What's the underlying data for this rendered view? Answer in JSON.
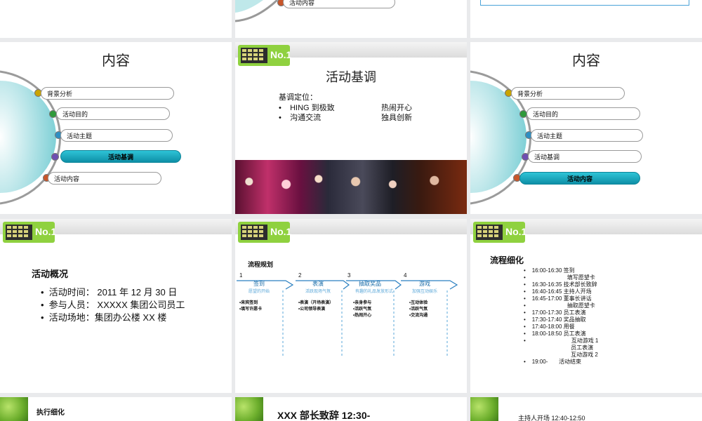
{
  "colors": {
    "teal_accent": "#1aa9bd",
    "menu_dots": [
      "#c9a400",
      "#2f9a3c",
      "#2f8fc2",
      "#6f4fb0",
      "#c8562a"
    ],
    "flow_arrow": "#2a7fc0",
    "flow_sub": "#5aa7d8"
  },
  "slide_top_left": {
    "menu_label": ""
  },
  "slide_top_middle": {
    "menu_label": "活动内容"
  },
  "contents_1": {
    "title": "内容",
    "items": [
      "背景分析",
      "活动目的",
      "活动主题",
      "活动基调",
      "活动内容"
    ],
    "active_index": 3
  },
  "tone": {
    "logo_text": "No.1",
    "title": "活动基调",
    "label": "基调定位：",
    "rows": [
      {
        "left": "HING 到极致",
        "right": "热闹开心"
      },
      {
        "left": "沟通交流",
        "right": "独具创新"
      }
    ]
  },
  "contents_2": {
    "title": "内容",
    "items": [
      "背景分析",
      "活动目的",
      "活动主题",
      "活动基调",
      "活动内容"
    ],
    "active_index": 4
  },
  "overview": {
    "title": "活动概况",
    "items": [
      "活动时间： 2011 年 12 月 30 日",
      "参与人员： XXXXX 集团公司员工",
      "活动场地：集团办公楼 XX 楼"
    ]
  },
  "flow": {
    "title": "流程规划",
    "steps": [
      {
        "num": "1",
        "name": "签到",
        "sub": "愿望的开始",
        "bullets": [
          "来宾签到",
          "填写许愿卡"
        ]
      },
      {
        "num": "2",
        "name": "表演",
        "sub": "活跃现场气氛",
        "bullets": [
          "表演（开场表演）",
          "公司领导表演"
        ]
      },
      {
        "num": "3",
        "name": "抽取奖品",
        "sub": "有趣的礼品发放形式",
        "bullets": [
          "亲身参与",
          "活跃气氛",
          "热闹开心"
        ]
      },
      {
        "num": "4",
        "name": "游戏",
        "sub": "加强互动娱乐",
        "bullets": [
          "互动体验",
          "活跃气氛",
          "交流沟通"
        ]
      }
    ]
  },
  "detail": {
    "title": "流程细化",
    "rows": [
      {
        "time": "16:00-16:30",
        "text": "签到"
      },
      {
        "time": "",
        "text": "填写愿望卡"
      },
      {
        "time": "16:30-16:35",
        "text": "技术部长致辞"
      },
      {
        "time": "16:40-16:45",
        "text": "主持人开场"
      },
      {
        "time": "16:45-17:00",
        "text": "董事长讲话"
      },
      {
        "time": "",
        "text": "抽取愿望卡"
      },
      {
        "time": "17:00-17:30",
        "text": "员工表演"
      },
      {
        "time": "17:30-17:40",
        "text": "奖品抽取"
      },
      {
        "time": "17:40-18:00",
        "text": "用餐"
      },
      {
        "time": "18:00-18:50",
        "text": "员工表演"
      },
      {
        "time": "",
        "text": "互动游戏 1"
      },
      {
        "time": "",
        "text": "员工表演"
      },
      {
        "time": "",
        "text": "互动游戏 2"
      },
      {
        "time": "19:00-",
        "text": "活动结束"
      }
    ]
  },
  "bottom": {
    "left_title": "执行细化",
    "middle_title": "XXX 部长致辞 12:30-",
    "right_title": "主持人开场 12:40-12:50"
  }
}
